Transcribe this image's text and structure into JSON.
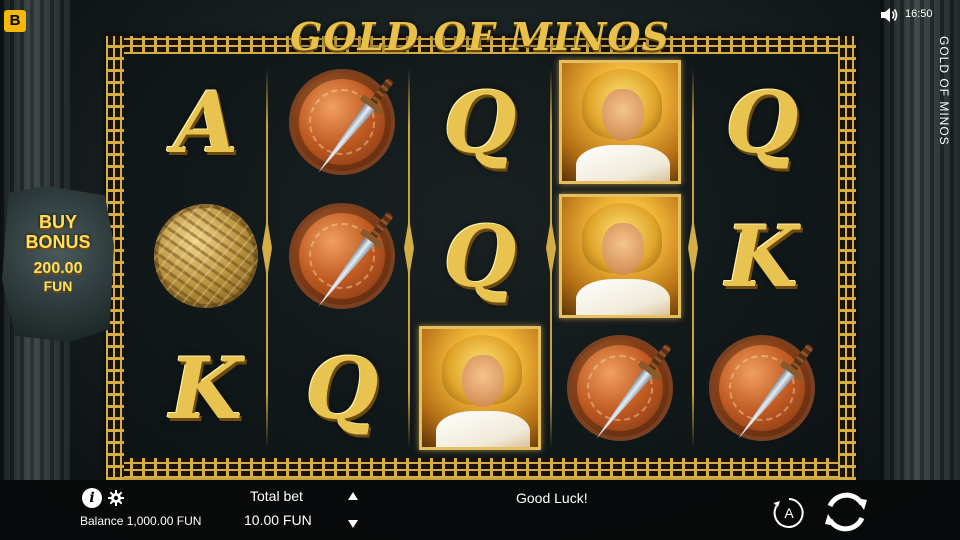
{
  "header": {
    "brand_logo": "B",
    "clock": "16:50",
    "side_title": "GOLD OF MINOS"
  },
  "game": {
    "title": "GOLD OF MINOS",
    "reels": [
      [
        "A",
        "yarn-ball",
        "K"
      ],
      [
        "shield-dagger",
        "shield-dagger",
        "Q"
      ],
      [
        "Q",
        "Q",
        "hero"
      ],
      [
        "hero",
        "hero",
        "shield-dagger"
      ],
      [
        "Q",
        "K",
        "shield-dagger"
      ]
    ]
  },
  "buy_bonus": {
    "label": "BUY\nBONUS",
    "price": "200.00",
    "currency": "FUN"
  },
  "footer": {
    "balance": "Balance 1,000.00 FUN",
    "total_bet_label": "Total bet",
    "total_bet_value": "10.00 FUN",
    "message": "Good Luck!",
    "autoplay_label": "A"
  },
  "colors": {
    "gold": "#c9a23b",
    "brand": "#f5b800",
    "bonus_text": "#ffe05a"
  }
}
